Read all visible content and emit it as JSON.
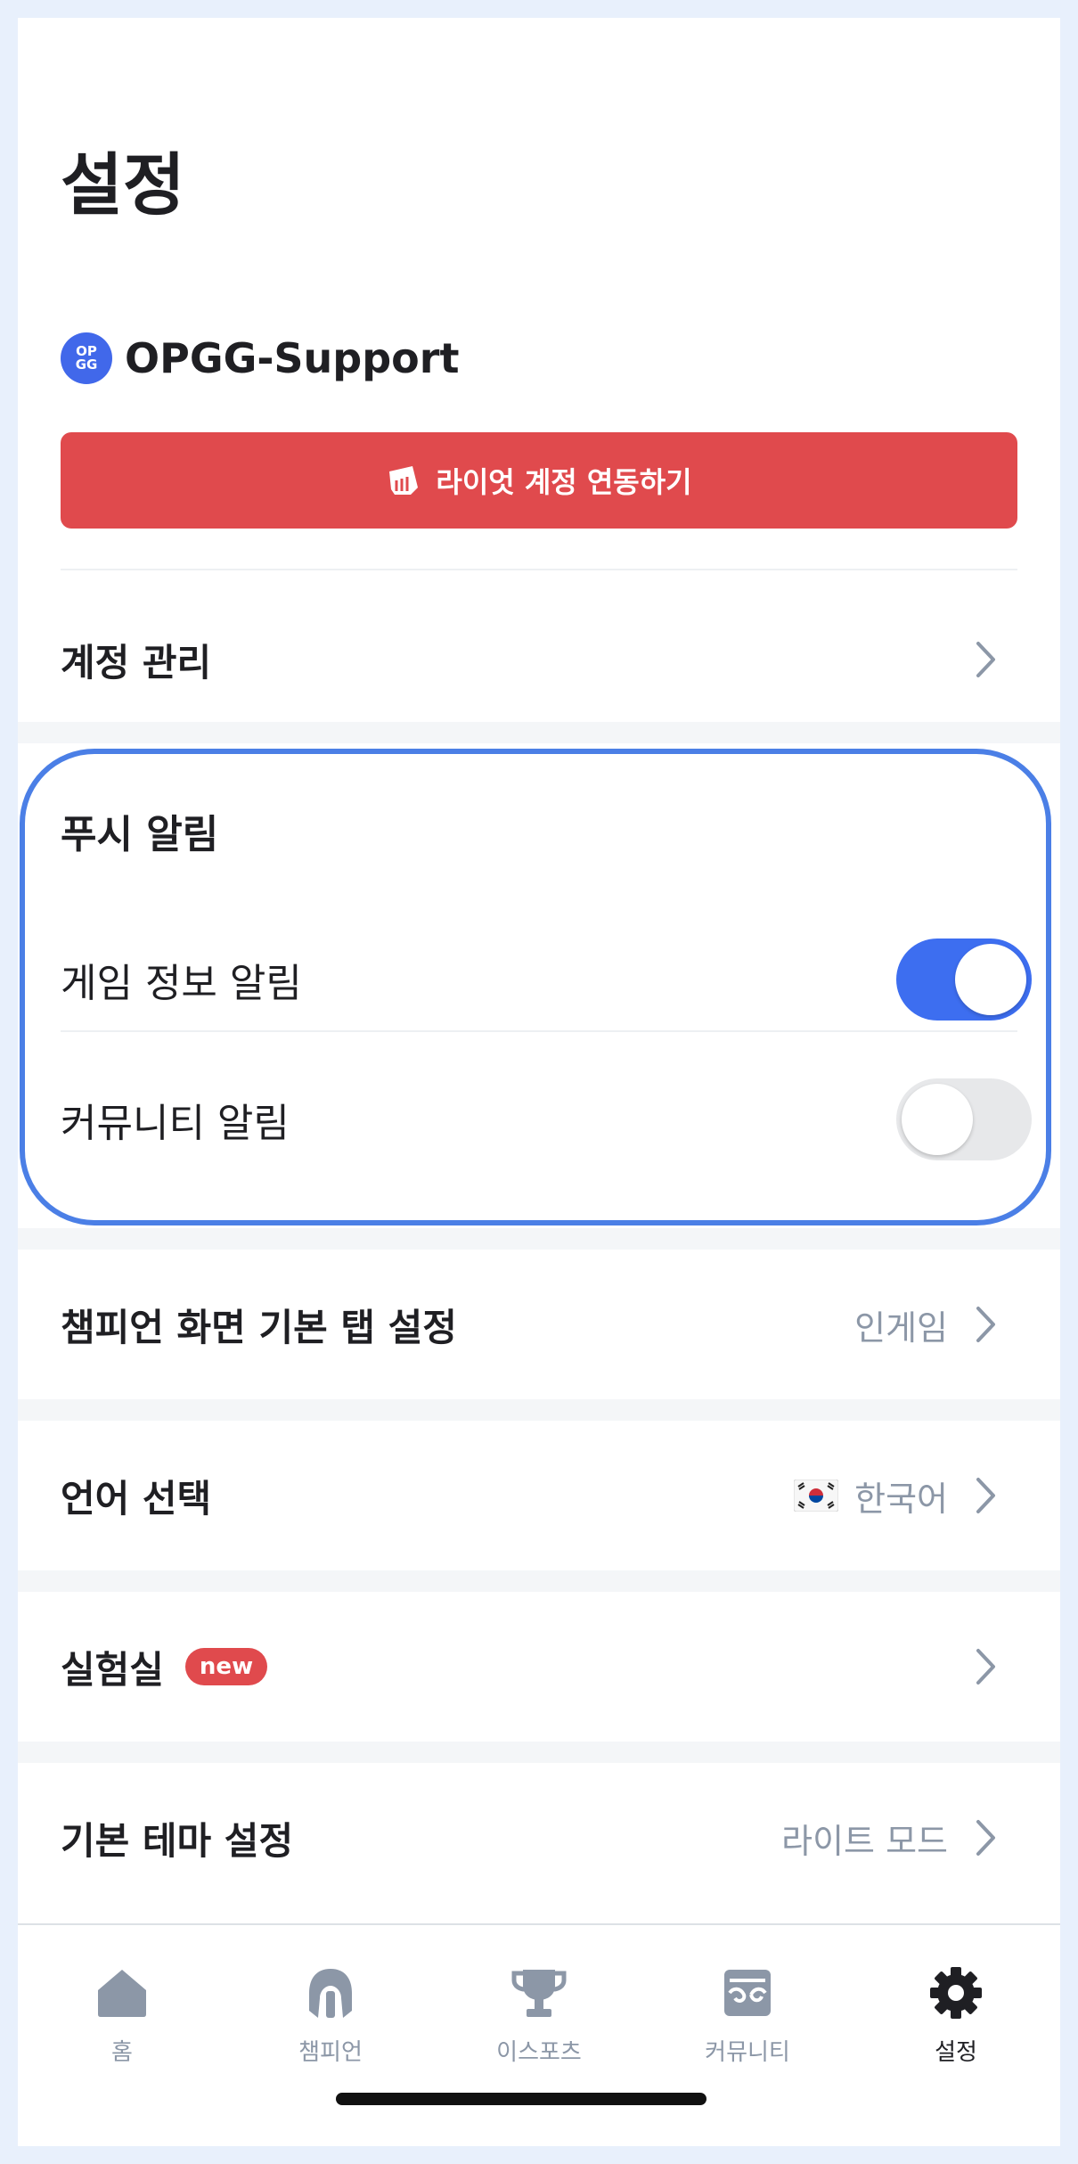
{
  "header": {
    "title": "설정"
  },
  "account": {
    "logo_text_top": "OP",
    "logo_text_bottom": "GG",
    "name": "OPGG-Support"
  },
  "riot_link": {
    "label": "라이엇 계정 연동하기"
  },
  "account_management": {
    "label": "계정 관리"
  },
  "push": {
    "title": "푸시 알림",
    "items": [
      {
        "label": "게임 정보 알림",
        "enabled": true
      },
      {
        "label": "커뮤니티 알림",
        "enabled": false
      }
    ]
  },
  "settings": {
    "champion_tab": {
      "label": "챔피언 화면 기본 탭 설정",
      "value": "인게임"
    },
    "language": {
      "label": "언어 선택",
      "value": "한국어",
      "flag": "korea-flag"
    },
    "lab": {
      "label": "실험실",
      "badge": "new"
    },
    "theme": {
      "label": "기본 테마 설정",
      "value": "라이트 모드"
    }
  },
  "tabbar": {
    "items": [
      {
        "label": "홈",
        "icon": "home-icon",
        "active": false
      },
      {
        "label": "챔피언",
        "icon": "champion-icon",
        "active": false
      },
      {
        "label": "이스포츠",
        "icon": "trophy-icon",
        "active": false
      },
      {
        "label": "커뮤니티",
        "icon": "community-icon",
        "active": false
      },
      {
        "label": "설정",
        "icon": "gear-icon",
        "active": true
      }
    ]
  },
  "colors": {
    "accent": "#3d6ef0",
    "riot_red": "#e04a4d",
    "highlight": "#4b7fe6",
    "muted_text": "#8c97a7"
  }
}
